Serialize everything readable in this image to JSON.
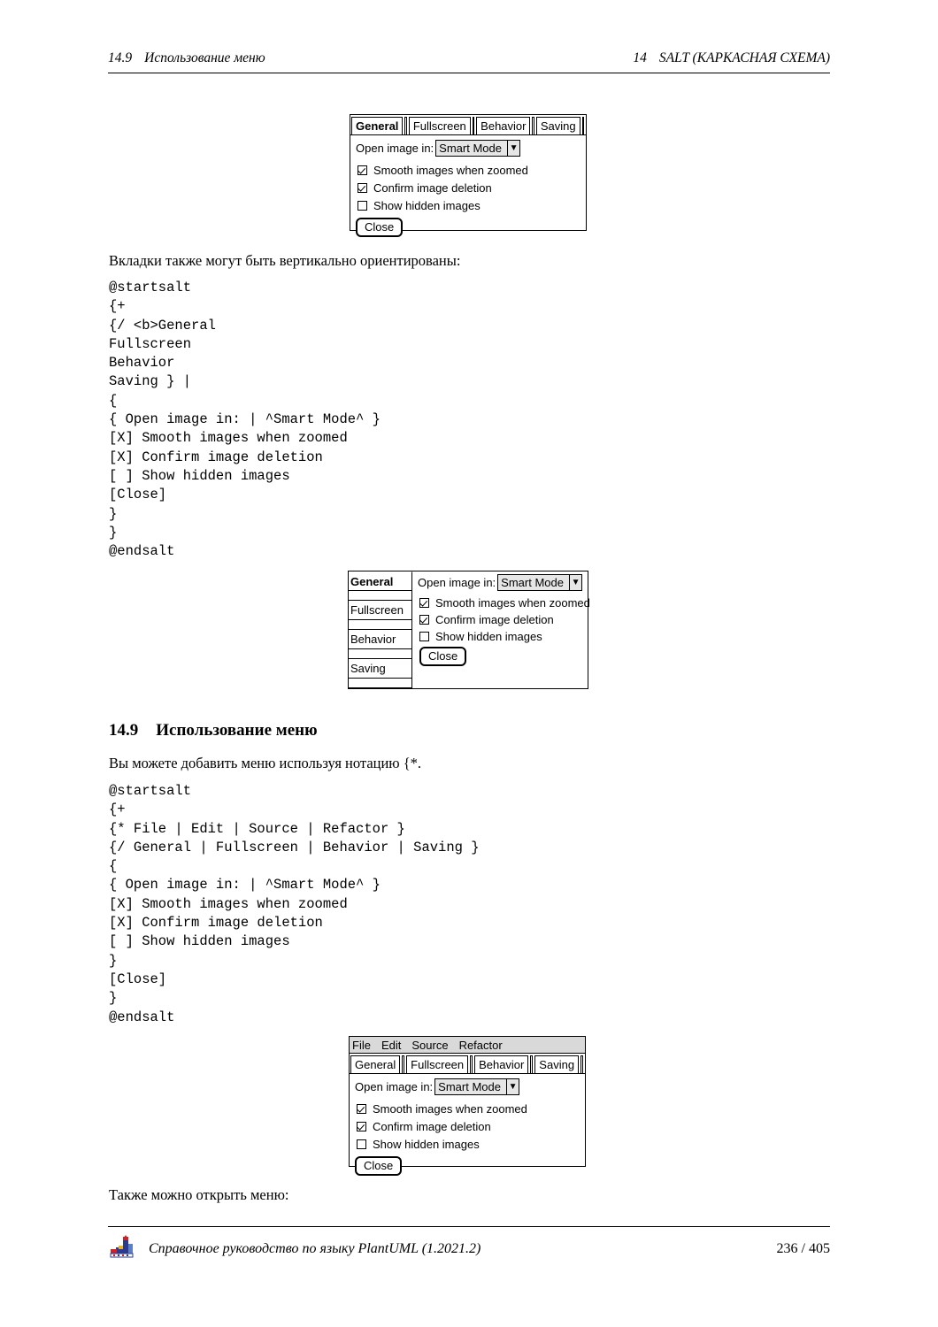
{
  "header": {
    "left_number": "14.9",
    "left_title": "Использование меню",
    "right_number": "14",
    "right_title": "SALT (КАРКАСНАЯ СХЕМА)"
  },
  "paragraphs": {
    "p1": "Вкладки также могут быть вертикально ориентированы:",
    "p2": "Вы можете добавить меню используя нотацию {*.",
    "p3": "Также можно открыть меню:"
  },
  "section": {
    "number": "14.9",
    "title": "Использование меню"
  },
  "code_blocks": {
    "block1": "@startsalt\n{+\n{/ <b>General\nFullscreen\nBehavior\nSaving } |\n{\n{ Open image in: | ^Smart Mode^ }\n[X] Smooth images when zoomed\n[X] Confirm image deletion\n[ ] Show hidden images\n[Close]\n}\n}\n@endsalt",
    "block2": "@startsalt\n{+\n{* File | Edit | Source | Refactor }\n{/ General | Fullscreen | Behavior | Saving }\n{\n{ Open image in: | ^Smart Mode^ }\n[X] Smooth images when zoomed\n[X] Confirm image deletion\n[ ] Show hidden images\n}\n[Close]\n}\n@endsalt"
  },
  "mockup1": {
    "tabs": [
      {
        "label": "General",
        "active": true
      },
      {
        "label": "Fullscreen",
        "active": false
      },
      {
        "label": "Behavior",
        "active": false
      },
      {
        "label": "Saving",
        "active": false
      }
    ],
    "combo_label": "Open image in:",
    "combo_value": "Smart Mode",
    "combo_arrow": "▼",
    "checkboxes": [
      {
        "label": "Smooth images when zoomed",
        "checked": true
      },
      {
        "label": "Confirm image deletion",
        "checked": true
      },
      {
        "label": "Show hidden images",
        "checked": false
      }
    ],
    "close_label": "Close"
  },
  "mockup2": {
    "tabs": [
      {
        "label": "General",
        "active": true
      },
      {
        "label": "Fullscreen",
        "active": false
      },
      {
        "label": "Behavior",
        "active": false
      },
      {
        "label": "Saving",
        "active": false
      }
    ],
    "combo_label": "Open image in:",
    "combo_value": "Smart Mode",
    "combo_arrow": "▼",
    "checkboxes": [
      {
        "label": "Smooth images when zoomed",
        "checked": true
      },
      {
        "label": "Confirm image deletion",
        "checked": true
      },
      {
        "label": "Show hidden images",
        "checked": false
      }
    ],
    "close_label": "Close"
  },
  "mockup3": {
    "menu": [
      "File",
      "Edit",
      "Source",
      "Refactor"
    ],
    "tabs": [
      {
        "label": "General",
        "active": false
      },
      {
        "label": "Fullscreen",
        "active": false
      },
      {
        "label": "Behavior",
        "active": false
      },
      {
        "label": "Saving",
        "active": false
      }
    ],
    "combo_label": "Open image in:",
    "combo_value": "Smart Mode",
    "combo_arrow": "▼",
    "checkboxes": [
      {
        "label": "Smooth images when zoomed",
        "checked": true
      },
      {
        "label": "Confirm image deletion",
        "checked": true
      },
      {
        "label": "Show hidden images",
        "checked": false
      }
    ],
    "close_label": "Close"
  },
  "footer": {
    "text": "Справочное руководство по языку PlantUML (1.2021.2)",
    "page": "236 / 405",
    "logo_name": "plantuml-logo"
  }
}
